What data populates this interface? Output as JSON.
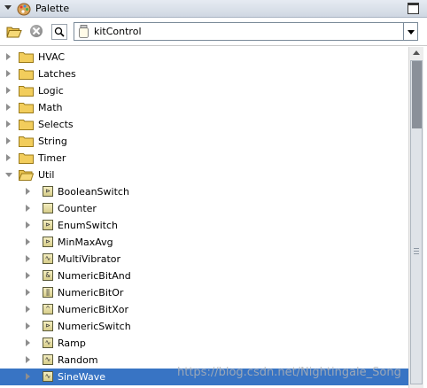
{
  "window": {
    "title": "Palette"
  },
  "toolbar": {
    "palette_selected": "kitControl",
    "open_icon": "folder-open-icon",
    "close_icon": "close-circle-icon",
    "find_icon": "magnifier-icon"
  },
  "tree": {
    "folders": [
      {
        "label": "HVAC",
        "expanded": false
      },
      {
        "label": "Latches",
        "expanded": false
      },
      {
        "label": "Logic",
        "expanded": false
      },
      {
        "label": "Math",
        "expanded": false
      },
      {
        "label": "Selects",
        "expanded": false
      },
      {
        "label": "String",
        "expanded": false
      },
      {
        "label": "Timer",
        "expanded": false
      },
      {
        "label": "Util",
        "expanded": true
      }
    ],
    "util_children": [
      {
        "label": "BooleanSwitch",
        "glyph": "⊳"
      },
      {
        "label": "Counter",
        "glyph": ""
      },
      {
        "label": "EnumSwitch",
        "glyph": "⊳"
      },
      {
        "label": "MinMaxAvg",
        "glyph": "⊳"
      },
      {
        "label": "MultiVibrator",
        "glyph": "∿"
      },
      {
        "label": "NumericBitAnd",
        "glyph": "&"
      },
      {
        "label": "NumericBitOr",
        "glyph": "‖"
      },
      {
        "label": "NumericBitXor",
        "glyph": "^"
      },
      {
        "label": "NumericSwitch",
        "glyph": "⊳"
      },
      {
        "label": "Ramp",
        "glyph": "∿"
      },
      {
        "label": "Random",
        "glyph": "∿"
      },
      {
        "label": "SineWave",
        "glyph": "∿",
        "selected": true
      }
    ]
  },
  "watermark": "https://blog.csdn.net/Nightingale_Song",
  "colors": {
    "selection": "#3874c4",
    "folder": "#f2cd5c",
    "title_bar": "#dde3eb"
  }
}
